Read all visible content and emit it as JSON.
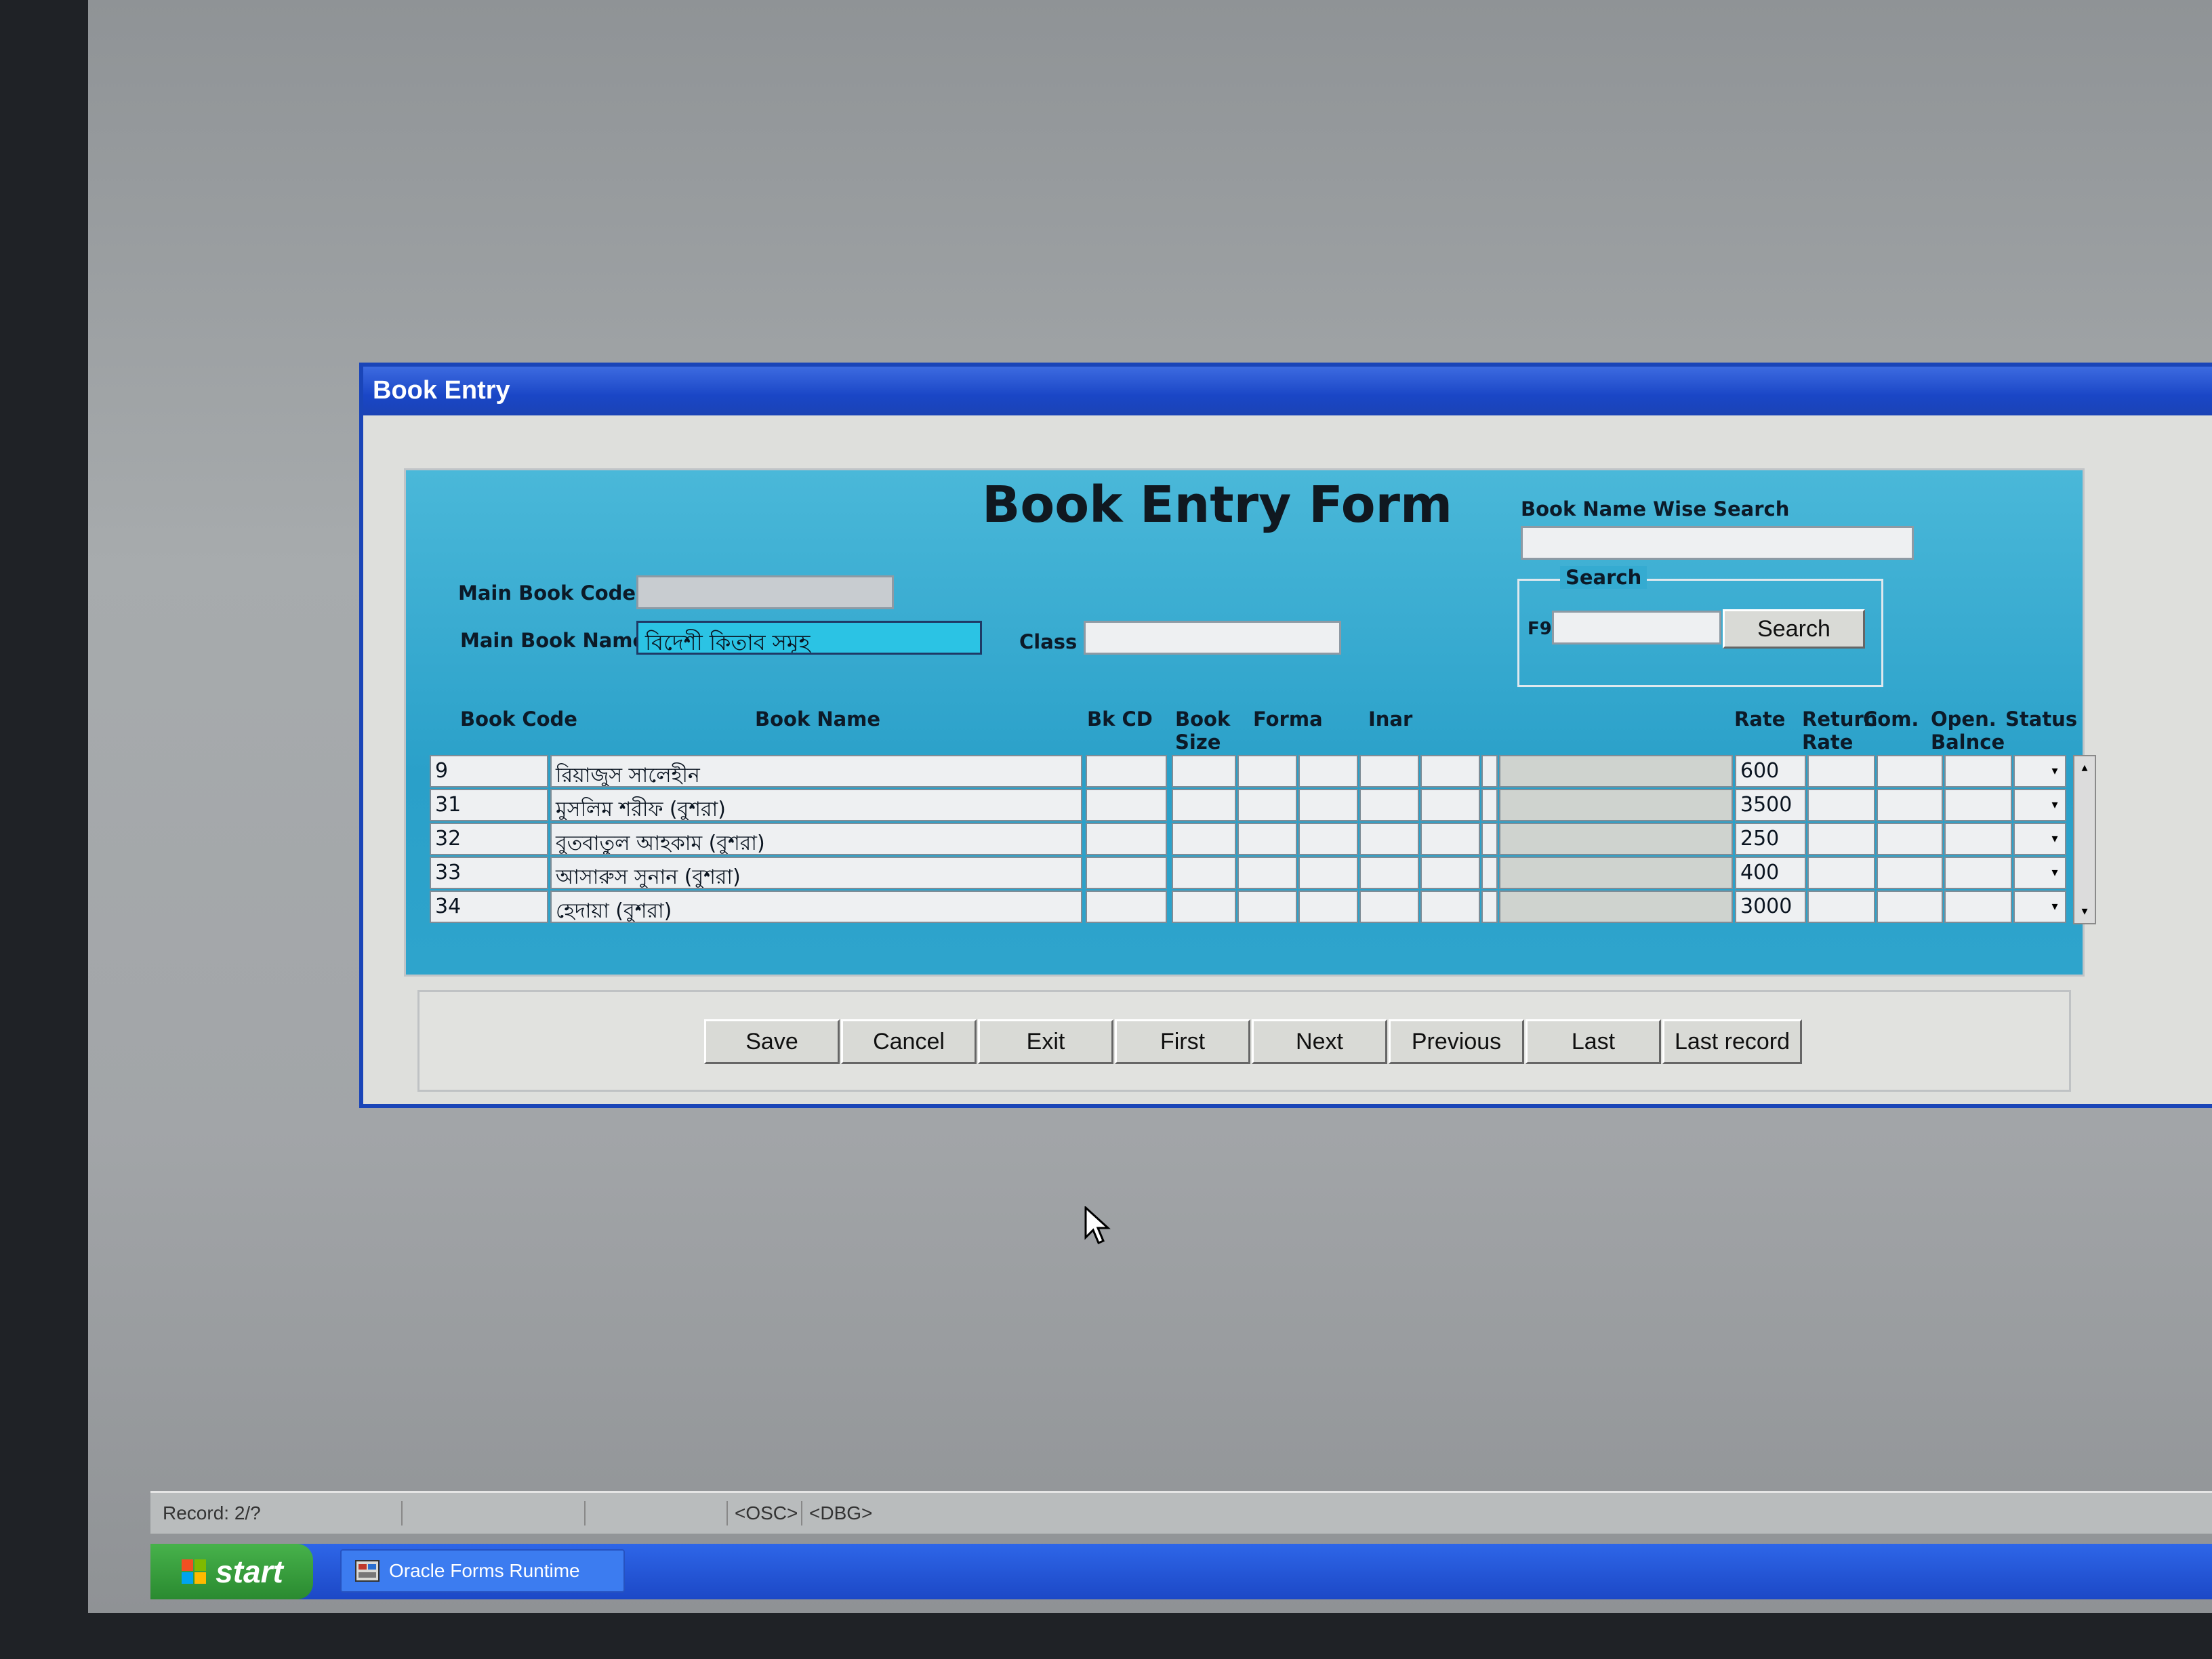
{
  "window": {
    "title": "Book Entry"
  },
  "form": {
    "title": "Book Entry Form",
    "main_book_code": {
      "label": "Main Book Code",
      "value": ""
    },
    "main_book_name": {
      "label": "Main Book Name",
      "value": "বিদেশী কিতাব সমূহ"
    },
    "class": {
      "label": "Class",
      "value": ""
    },
    "name_search": {
      "label": "Book Name Wise Search",
      "value": ""
    },
    "search_group": {
      "legend": "Search",
      "hotkey_label": "F9",
      "value": "",
      "button_label": "Search"
    }
  },
  "grid": {
    "headers": {
      "book_code": "Book Code",
      "book_name": "Book Name",
      "bk_cd": "Bk CD",
      "book_size": "Book Size",
      "forma": "Forma",
      "inar": "Inar",
      "rate": "Rate",
      "return_rate": "Return Rate",
      "com": "Com.",
      "open_balance": "Open. Balnce",
      "status": "Status"
    },
    "rows": [
      {
        "code": "9",
        "name": "রিয়াজুস সালেহীন",
        "rate": "600"
      },
      {
        "code": "31",
        "name": "মুসলিম শরীফ (বুশরা)",
        "rate": "3500"
      },
      {
        "code": "32",
        "name": "বুতবাতুল আহকাম (বুশরা)",
        "rate": "250"
      },
      {
        "code": "33",
        "name": "আসারুস সুনান (বুশরা)",
        "rate": "400"
      },
      {
        "code": "34",
        "name": "হেদায়া (বুশরা)",
        "rate": "3000"
      }
    ]
  },
  "buttons": {
    "save": "Save",
    "cancel": "Cancel",
    "exit": "Exit",
    "first": "First",
    "next": "Next",
    "previous": "Previous",
    "last": "Last",
    "last_record": "Last record"
  },
  "statusbar": {
    "record": "Record: 2/?",
    "osc": "<OSC>",
    "dbg": "<DBG>"
  },
  "taskbar": {
    "start_label": "start",
    "task_label": "Oracle Forms Runtime"
  },
  "icons": {
    "start": "windows-flag-icon",
    "task": "oracle-forms-icon",
    "dropdown": "chevron-down-icon",
    "cursor": "mouse-pointer-icon"
  },
  "colors": {
    "form_canvas": "#2aa0c9",
    "titlebar": "#1a46c6",
    "active_field": "#2bc3e4",
    "taskbar": "#1c48c6",
    "start_button": "#2a8a30"
  }
}
